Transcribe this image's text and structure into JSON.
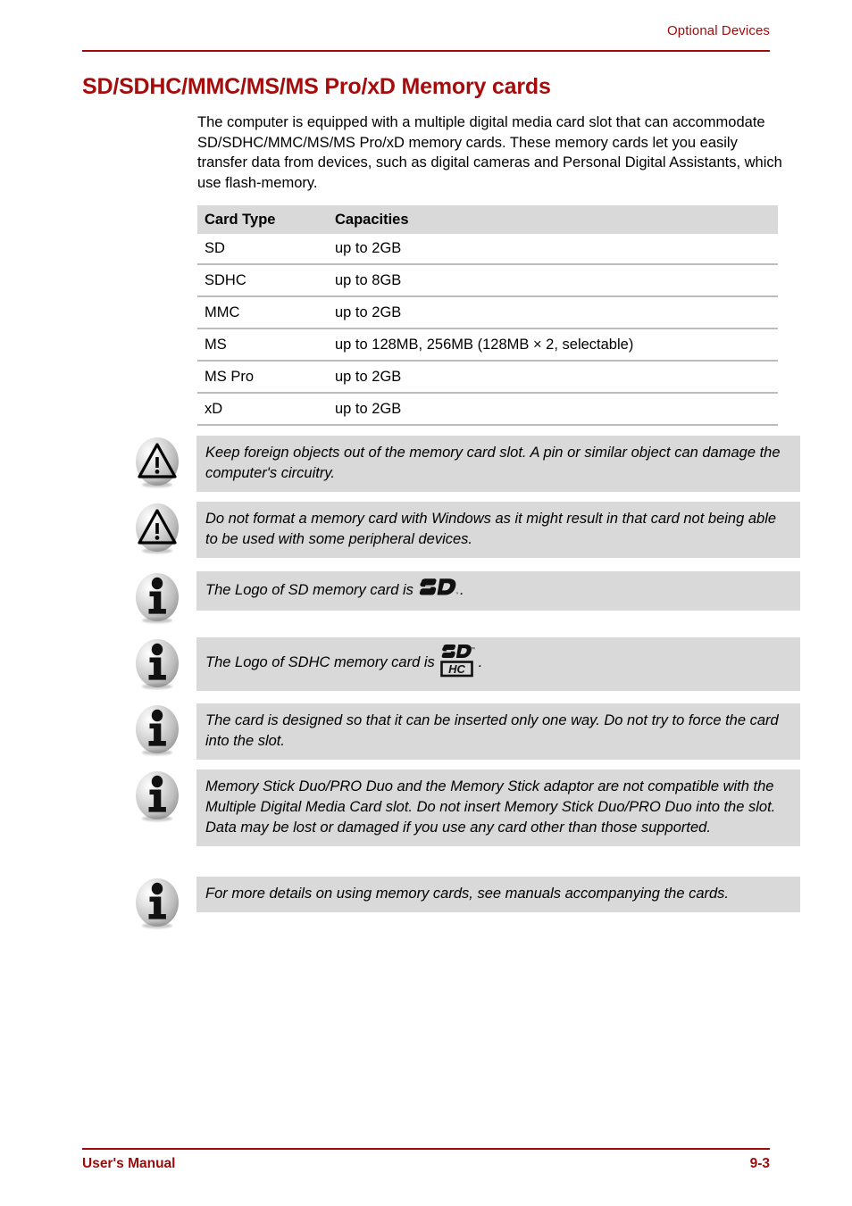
{
  "header": {
    "running_title": "Optional Devices",
    "accent_color": "#9e0b0b"
  },
  "section": {
    "title": "SD/SDHC/MMC/MS/MS Pro/xD Memory cards",
    "intro": "The computer is equipped with a multiple digital media card slot that can accommodate SD/SDHC/MMC/MS/MS Pro/xD memory cards. These memory cards let you easily transfer data from devices, such as digital cameras and Personal Digital Assistants, which use flash-memory."
  },
  "table": {
    "headers": [
      "Card Type",
      "Capacities"
    ],
    "rows": [
      {
        "type": "SD",
        "capacity": "up to 2GB"
      },
      {
        "type": "SDHC",
        "capacity": "up to 8GB"
      },
      {
        "type": "MMC",
        "capacity": "up to 2GB"
      },
      {
        "type": "MS",
        "capacity": "up to 128MB, 256MB (128MB × 2, selectable)"
      },
      {
        "type": "MS Pro",
        "capacity": "up to 2GB"
      },
      {
        "type": "xD",
        "capacity": "up to 2GB"
      }
    ]
  },
  "callouts": [
    {
      "icon": "caution-icon",
      "text": "Keep foreign objects out of the memory card slot. A pin or similar object can damage the computer's circuitry."
    },
    {
      "icon": "caution-icon",
      "text": "Do not format a memory card with Windows as it might result in that card not being able to be used with some peripheral devices."
    },
    {
      "icon": "info-icon",
      "text_before": "The Logo of SD memory card is",
      "logo": "sd-logo",
      "text_after": "."
    },
    {
      "icon": "info-icon",
      "text_before": "The Logo of SDHC memory card is",
      "logo": "sdhc-logo",
      "text_after": "."
    },
    {
      "icon": "info-icon",
      "text": "The card is designed so that it can be inserted only one way. Do not try to force the card into the slot."
    },
    {
      "icon": "info-icon",
      "text": "Memory Stick Duo/PRO Duo and the Memory Stick adaptor are not compatible with the Multiple Digital Media Card slot. Do not insert Memory Stick Duo/PRO Duo into the slot. Data may be lost or damaged if you use any card other than those supported."
    },
    {
      "icon": "info-icon",
      "text": "For more details on using memory cards, see manuals accompanying the cards."
    }
  ],
  "footer": {
    "left": "User's Manual",
    "right": "9-3"
  }
}
